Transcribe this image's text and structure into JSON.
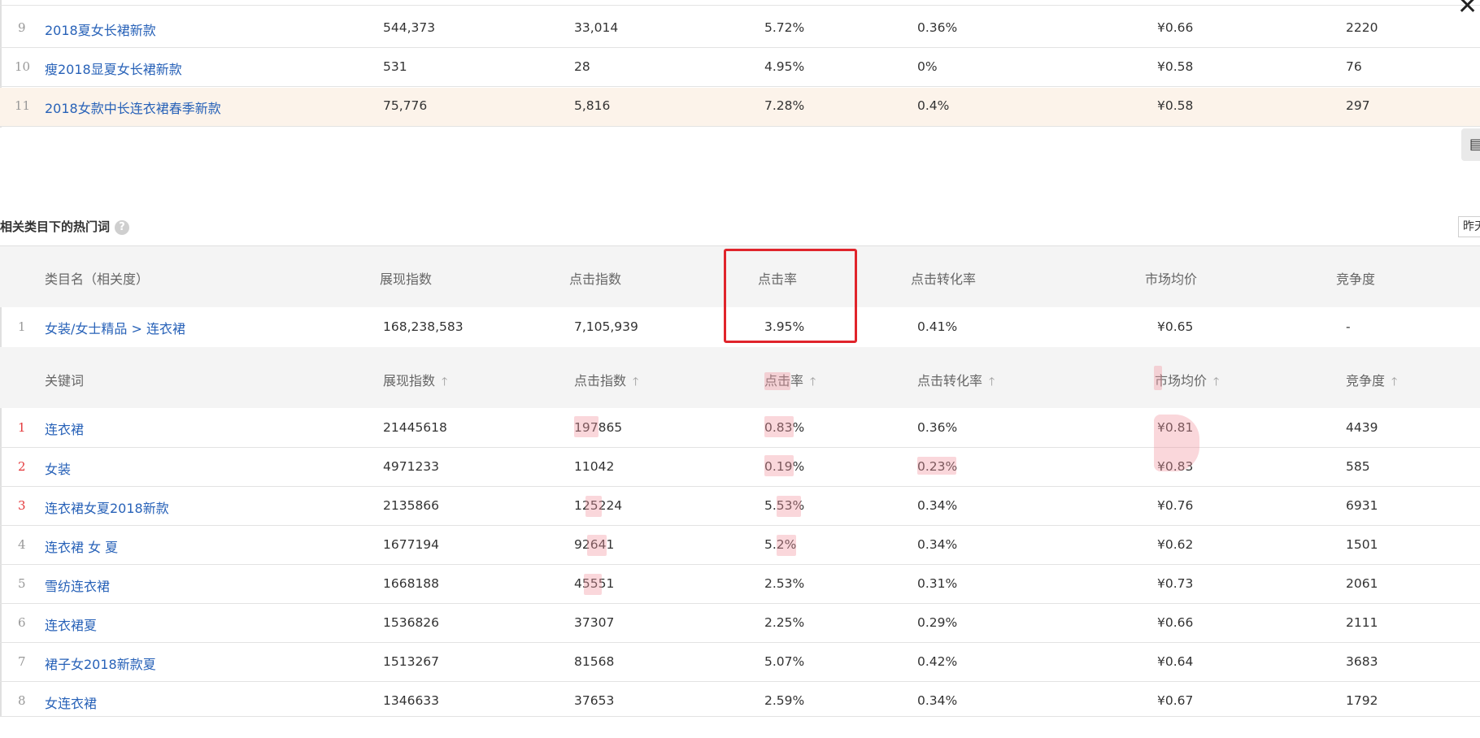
{
  "top_table": {
    "rows": [
      {
        "index": "9",
        "name": "2018夏女长裙新款",
        "impressions": "544,373",
        "clicks": "33,014",
        "ctr": "5.72%",
        "cvr": "0.36%",
        "price": "¥0.66",
        "competition": "2220"
      },
      {
        "index": "10",
        "name": "瘦2018显夏女长裙新款",
        "impressions": "531",
        "clicks": "28",
        "ctr": "4.95%",
        "cvr": "0%",
        "price": "¥0.58",
        "competition": "76"
      },
      {
        "index": "11",
        "name": "2018女款中长连衣裙春季新款",
        "impressions": "75,776",
        "clicks": "5,816",
        "ctr": "7.28%",
        "cvr": "0.4%",
        "price": "¥0.58",
        "competition": "297"
      }
    ]
  },
  "related_section": {
    "title": "相关类目下的热门词",
    "help_icon": "?",
    "date_button": "昨天",
    "category_header": {
      "name": "类目名（相关度）",
      "impressions": "展现指数",
      "clicks": "点击指数",
      "ctr": "点击率",
      "cvr": "点击转化率",
      "price": "市场均价",
      "competition": "竞争度"
    },
    "category_row": {
      "index": "1",
      "name": "女装/女士精品 > 连衣裙",
      "impressions": "168,238,583",
      "clicks": "7,105,939",
      "ctr": "3.95%",
      "cvr": "0.41%",
      "price": "¥0.65",
      "competition": "-"
    },
    "keyword_header": {
      "name": "关键词",
      "impressions": "展现指数",
      "clicks": "点击指数",
      "ctr": "点击率",
      "cvr": "点击转化率",
      "price": "市场均价",
      "competition": "竞争度",
      "sort_icon": "sort-up-icon"
    },
    "keywords": [
      {
        "index": "1",
        "name": "连衣裙",
        "impressions": "21445618",
        "clicks": "197865",
        "ctr": "0.83%",
        "cvr": "0.36%",
        "price": "¥0.81",
        "competition": "4439"
      },
      {
        "index": "2",
        "name": "女装",
        "impressions": "4971233",
        "clicks": "11042",
        "ctr": "0.19%",
        "cvr": "0.23%",
        "price": "¥0.83",
        "competition": "585"
      },
      {
        "index": "3",
        "name": "连衣裙女夏2018新款",
        "impressions": "2135866",
        "clicks": "125224",
        "ctr": "5.53%",
        "cvr": "0.34%",
        "price": "¥0.76",
        "competition": "6931"
      },
      {
        "index": "4",
        "name": "连衣裙 女 夏",
        "impressions": "1677194",
        "clicks": "92641",
        "ctr": "5.2%",
        "cvr": "0.34%",
        "price": "¥0.62",
        "competition": "1501"
      },
      {
        "index": "5",
        "name": "雪纺连衣裙",
        "impressions": "1668188",
        "clicks": "45551",
        "ctr": "2.53%",
        "cvr": "0.31%",
        "price": "¥0.73",
        "competition": "2061"
      },
      {
        "index": "6",
        "name": "连衣裙夏",
        "impressions": "1536826",
        "clicks": "37307",
        "ctr": "2.25%",
        "cvr": "0.29%",
        "price": "¥0.66",
        "competition": "2111"
      },
      {
        "index": "7",
        "name": "裙子女2018新款夏",
        "impressions": "1513267",
        "clicks": "81568",
        "ctr": "5.07%",
        "cvr": "0.42%",
        "price": "¥0.64",
        "competition": "3683"
      },
      {
        "index": "8",
        "name": "女连衣裙",
        "impressions": "1346633",
        "clicks": "37653",
        "ctr": "2.59%",
        "cvr": "0.34%",
        "price": "¥0.67",
        "competition": "1792"
      }
    ]
  },
  "colors": {
    "link": "#2862b8",
    "rank_top": "#e4393c",
    "highlight_row": "#fcf3ea",
    "header_bg": "#f4f4f4",
    "annotation": "#e0242b"
  }
}
